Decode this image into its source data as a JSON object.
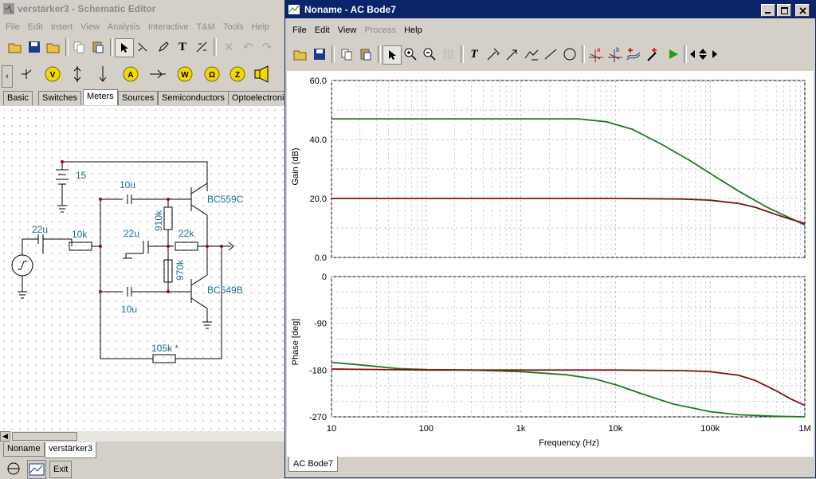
{
  "schematic": {
    "title": "verstärker3 - Schematic Editor",
    "menu": [
      "File",
      "Edit",
      "Insert",
      "View",
      "Analysis",
      "Interactive",
      "T&M",
      "Tools",
      "Help"
    ],
    "tabs": [
      "Basic",
      "Switches",
      "Meters",
      "Sources",
      "Semiconductors",
      "Optoelectronic"
    ],
    "active_tab": "Meters",
    "labels": {
      "battery": "15",
      "c1": "10u",
      "q1": "BC559C",
      "c_in": "22u",
      "r_in": "10k",
      "c_mid": "22u",
      "r_910": "910k",
      "r_22": "22k",
      "r_970": "970k",
      "q2": "BC549B",
      "c2": "10u",
      "r_fb": "105k *"
    },
    "bottom_tabs": [
      "Noname",
      "verstärker3"
    ],
    "active_bottom_tab": "verstärker3",
    "exit_label": "Exit"
  },
  "bode": {
    "title": "Noname - AC Bode7",
    "menu": [
      "File",
      "Edit",
      "View",
      "Process",
      "Help"
    ],
    "disabled_menu": [
      "Process"
    ],
    "tab_label": "AC Bode7",
    "colors": {
      "green": "#1e7a1e",
      "red": "#7a1414",
      "grid": "#bdbdbd"
    }
  },
  "chart_data": [
    {
      "type": "line",
      "xlabel": "",
      "ylabel": "Gain (dB)",
      "xscale": "log",
      "xlim": [
        10,
        1000000
      ],
      "ylim": [
        0,
        60
      ],
      "yticks": [
        0,
        20,
        40,
        60
      ],
      "ytick_labels": [
        "0.0",
        "20.0",
        "40.0",
        "60.0"
      ],
      "grid": true,
      "series": [
        {
          "color": "green",
          "x": [
            10,
            100,
            1000,
            4000,
            8000,
            15000,
            30000,
            60000,
            100000,
            200000,
            400000,
            1000000
          ],
          "y": [
            47,
            47,
            47,
            47,
            46,
            43.5,
            38.5,
            33,
            28.5,
            22.5,
            17,
            11
          ]
        },
        {
          "color": "red",
          "x": [
            10,
            100,
            1000,
            10000,
            50000,
            100000,
            200000,
            300000,
            500000,
            700000,
            1000000
          ],
          "y": [
            20,
            20,
            20,
            20,
            19.8,
            19.4,
            18.3,
            17,
            14.5,
            13,
            11.5
          ]
        }
      ]
    },
    {
      "type": "line",
      "xlabel": "Frequency (Hz)",
      "ylabel": "Phase [deg]",
      "xscale": "log",
      "xlim": [
        10,
        1000000
      ],
      "ylim": [
        -270,
        0
      ],
      "yticks": [
        0,
        -90,
        -180,
        -270
      ],
      "ytick_labels": [
        "0",
        "-90",
        "-180",
        "-270"
      ],
      "xticks": [
        10,
        100,
        1000,
        10000,
        100000,
        1000000
      ],
      "xtick_labels": [
        "10",
        "100",
        "1k",
        "10k",
        "100k",
        "1M"
      ],
      "grid": true,
      "series": [
        {
          "color": "green",
          "x": [
            10,
            20,
            50,
            100,
            300,
            1000,
            3000,
            6000,
            10000,
            20000,
            40000,
            100000,
            200000,
            500000,
            1000000
          ],
          "y": [
            -165,
            -170,
            -177,
            -179,
            -180,
            -183,
            -189,
            -197,
            -208,
            -227,
            -245,
            -260,
            -266,
            -269,
            -270
          ]
        },
        {
          "color": "red",
          "x": [
            10,
            100,
            1000,
            10000,
            50000,
            100000,
            200000,
            300000,
            500000,
            700000,
            1000000
          ],
          "y": [
            -178,
            -180,
            -180,
            -180,
            -181,
            -183,
            -190,
            -200,
            -220,
            -235,
            -248
          ]
        }
      ]
    }
  ]
}
